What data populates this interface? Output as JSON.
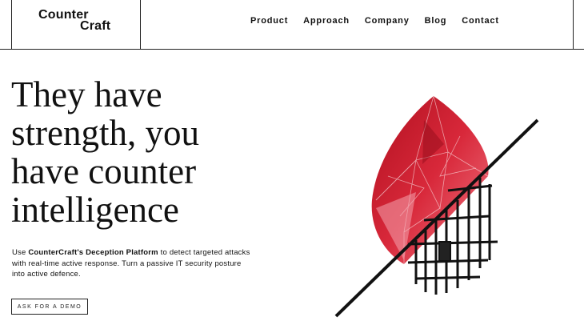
{
  "header": {
    "logo_line1": "Counter",
    "logo_line2": "Craft",
    "nav": [
      "Product",
      "Approach",
      "Company",
      "Blog",
      "Contact"
    ]
  },
  "hero": {
    "headline": [
      "They have",
      "strength, you",
      "have counter",
      "intelligence"
    ],
    "desc_pre": "Use ",
    "desc_bold": "CounterCraft's Deception Platform",
    "desc_post": " to detect targeted attacks with real-time active response. Turn a passive IT security posture into active defence.",
    "cta": "ASK FOR A DEMO"
  },
  "colors": {
    "accent": "#d8283a",
    "text": "#111111"
  }
}
